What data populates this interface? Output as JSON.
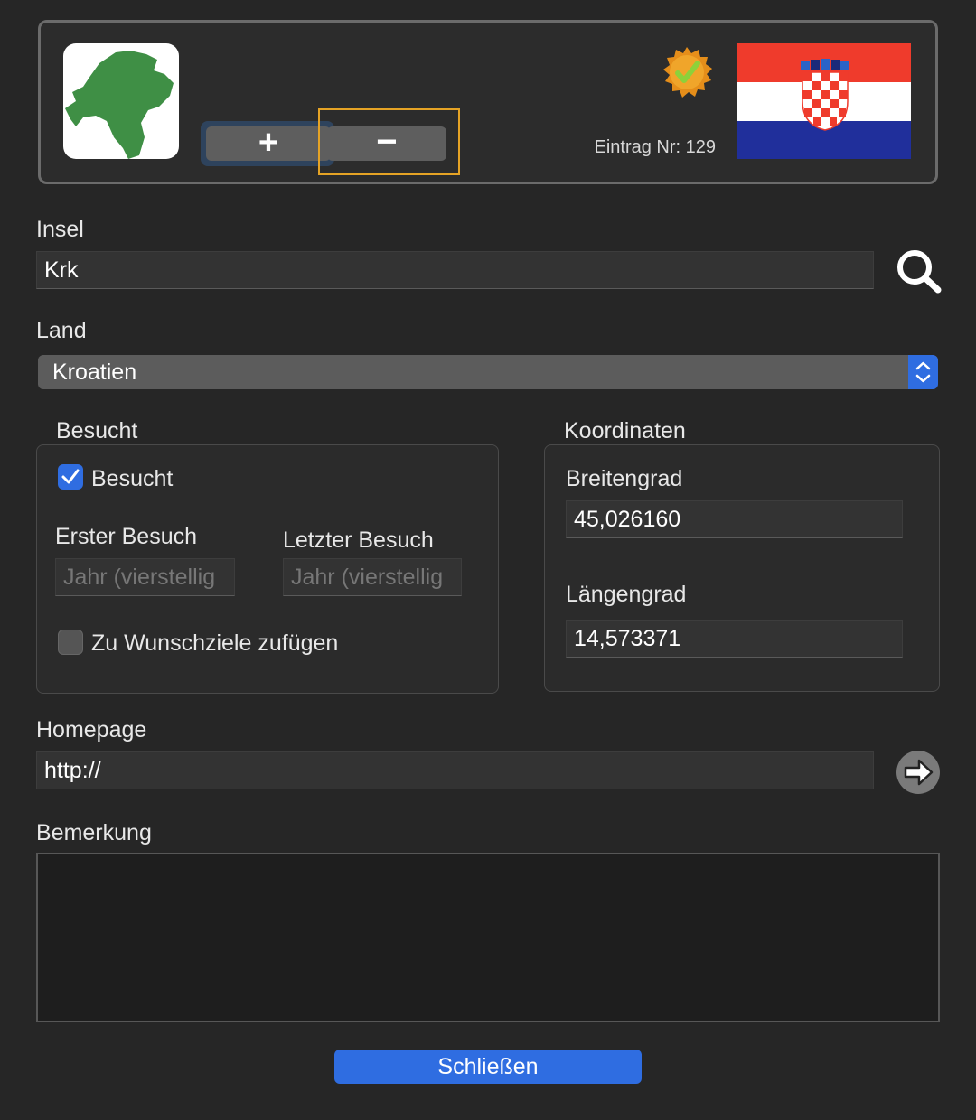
{
  "header": {
    "plus_label": "+",
    "minus_label": "−",
    "entry_label": "Eintrag Nr: 129",
    "flag_colors": [
      "#ef3b2c",
      "#ffffff",
      "#202f9b"
    ]
  },
  "island": {
    "label": "Insel",
    "value": "Krk"
  },
  "country": {
    "label": "Land",
    "value": "Kroatien"
  },
  "visited": {
    "group_label": "Besucht",
    "checkbox_label": "Besucht",
    "checked": true,
    "first_visit_label": "Erster Besuch",
    "first_visit_placeholder": "Jahr (vierstellig",
    "last_visit_label": "Letzter Besuch",
    "last_visit_placeholder": "Jahr (vierstellig",
    "wish_label": "Zu Wunschziele zufügen",
    "wish_checked": false
  },
  "coordinates": {
    "group_label": "Koordinaten",
    "lat_label": "Breitengrad",
    "lat_value": "45,026160",
    "lon_label": "Längengrad",
    "lon_value": "14,573371"
  },
  "homepage": {
    "label": "Homepage",
    "value": "http://"
  },
  "remark": {
    "label": "Bemerkung",
    "value": ""
  },
  "close_label": "Schließen",
  "colors": {
    "accent": "#2f6de1",
    "highlight": "#e5a325",
    "island_green": "#3f8f45"
  }
}
